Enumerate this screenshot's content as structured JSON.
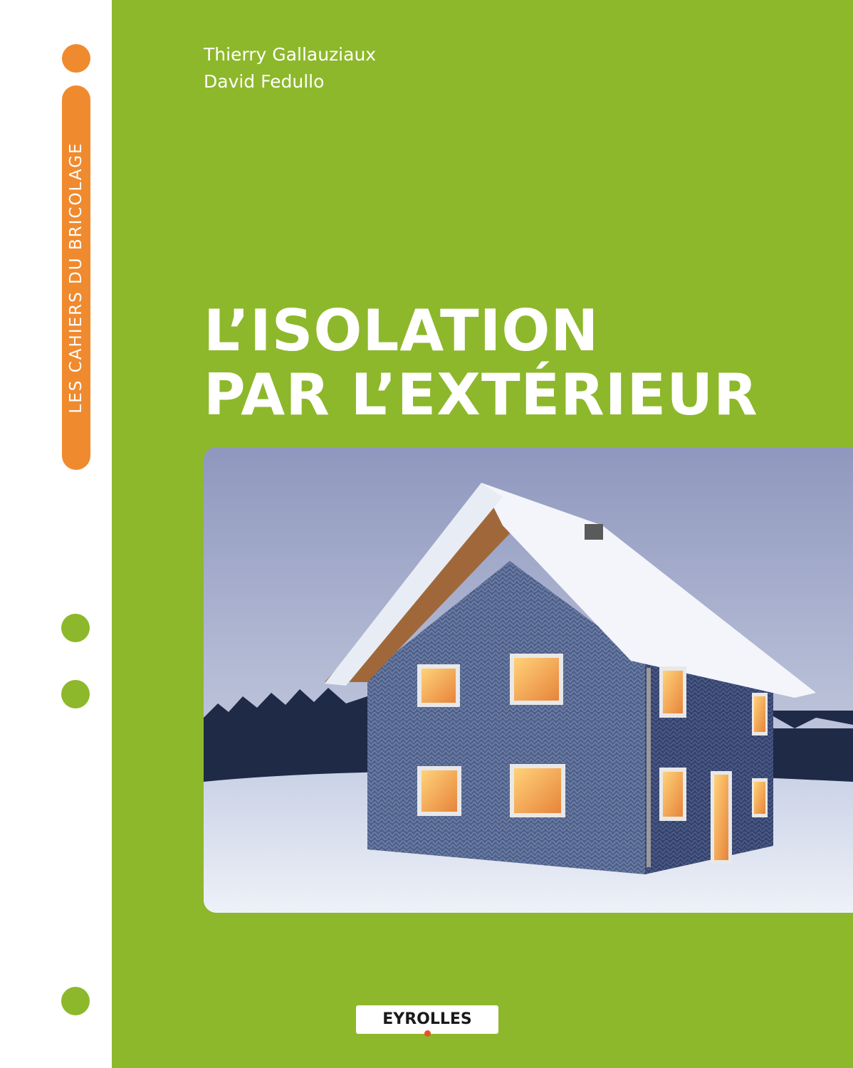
{
  "colors": {
    "cover_green": "#8db82b",
    "accent_orange": "#f08a2e",
    "strip_white": "#ffffff",
    "title_white": "#ffffff"
  },
  "series": {
    "label": "LES CAHIERS DU BRICOLAGE"
  },
  "authors": [
    "Thierry Gallauziaux",
    "David Fedullo"
  ],
  "title": {
    "line1": "L’ISOLATION",
    "line2": "PAR L’EXTÉRIEUR"
  },
  "publisher": {
    "name": "EYROLLES"
  },
  "icons": {
    "cover_photo": "knitted-house-in-snow-photo",
    "binder_dots": "binder-hole-dots"
  }
}
